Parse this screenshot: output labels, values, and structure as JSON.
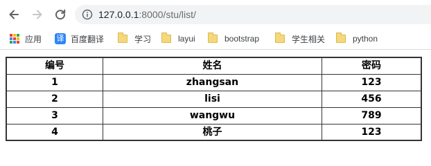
{
  "browser": {
    "url_host": "127.0.0.1",
    "url_rest": ":8000/stu/list/"
  },
  "bookmarks": [
    {
      "label": "应用",
      "icon": "apps-grid-icon"
    },
    {
      "label": "百度翻译",
      "icon": "baidu-translate-icon",
      "icon_text": "译"
    },
    {
      "label": "学习",
      "icon": "folder-icon"
    },
    {
      "label": "layui",
      "icon": "folder-icon"
    },
    {
      "label": "bootstrap",
      "icon": "folder-icon"
    },
    {
      "label": "学生相关",
      "icon": "folder-icon"
    },
    {
      "label": "python",
      "icon": "folder-icon"
    }
  ],
  "table": {
    "headers": [
      "编号",
      "姓名",
      "密码"
    ],
    "rows": [
      [
        "1",
        "zhangsan",
        "123"
      ],
      [
        "2",
        "lisi",
        "456"
      ],
      [
        "3",
        "wangwu",
        "789"
      ],
      [
        "4",
        "桃子",
        "123"
      ]
    ]
  },
  "colors": {
    "apps_grid": [
      "#ea4335",
      "#fbbc05",
      "#34a853",
      "#4285f4",
      "#ea4335",
      "#fbbc05",
      "#34a853",
      "#4285f4",
      "#ea4335"
    ]
  }
}
